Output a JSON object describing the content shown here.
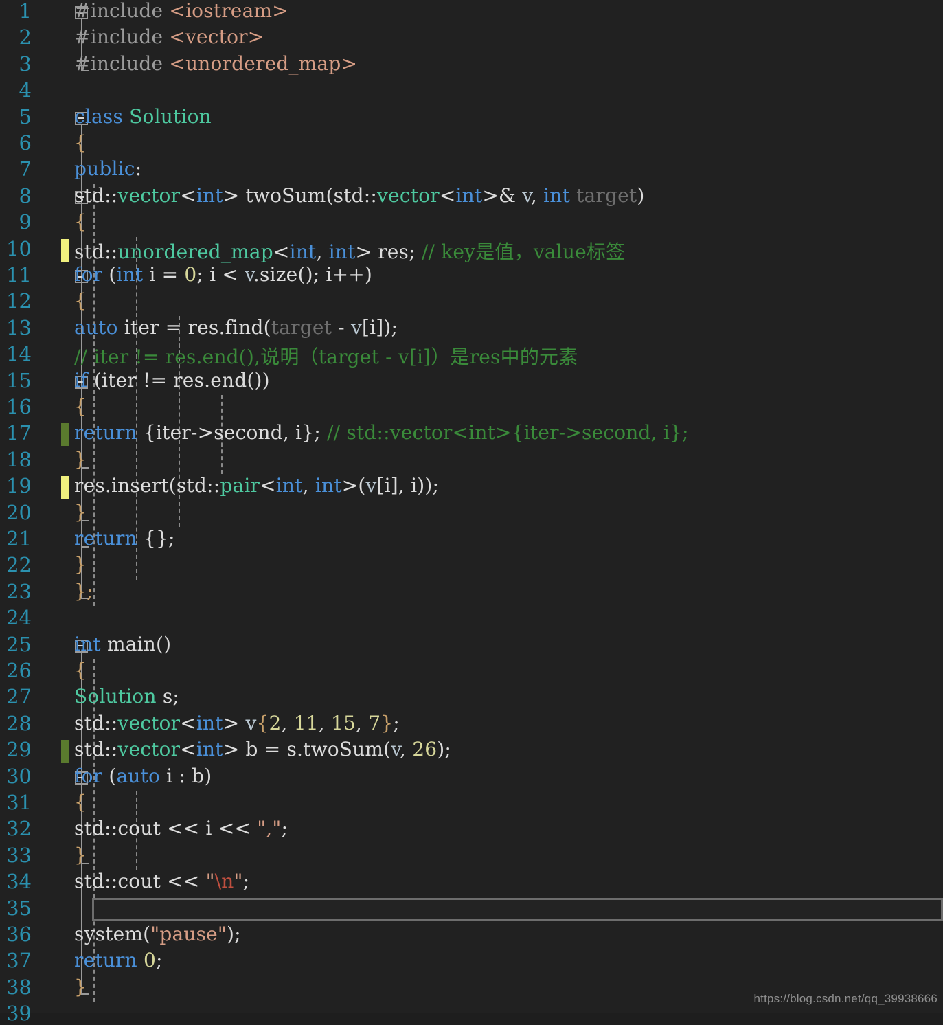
{
  "editor": {
    "theme_name": "dark",
    "background": "#212121",
    "line_number_color": "#2b91af",
    "font_size_px": 28,
    "line_height_px": 38.4,
    "current_line": 35,
    "total_visible_lines": 39,
    "change_markers": [
      {
        "line": 10,
        "color": "#f0f07e",
        "kind": "unsaved"
      },
      {
        "line": 17,
        "color": "#5a7a2e",
        "kind": "saved"
      },
      {
        "line": 19,
        "color": "#f0f07e",
        "kind": "unsaved"
      },
      {
        "line": 29,
        "color": "#5a7a2e",
        "kind": "saved"
      }
    ],
    "fold_markers": [
      1,
      5,
      8,
      11,
      15,
      25,
      30
    ],
    "watermark": "https://blog.csdn.net/qq_39938666",
    "line_numbers": [
      "1",
      "2",
      "3",
      "4",
      "5",
      "6",
      "7",
      "8",
      "9",
      "10",
      "11",
      "12",
      "13",
      "14",
      "15",
      "16",
      "17",
      "18",
      "19",
      "20",
      "21",
      "22",
      "23",
      "24",
      "25",
      "26",
      "27",
      "28",
      "29",
      "30",
      "31",
      "32",
      "33",
      "34",
      "35",
      "36",
      "37",
      "38",
      "39"
    ],
    "lines": [
      {
        "n": 1,
        "text": "#include <iostream>"
      },
      {
        "n": 2,
        "text": "#include <vector>"
      },
      {
        "n": 3,
        "text": "#include <unordered_map>"
      },
      {
        "n": 4,
        "text": ""
      },
      {
        "n": 5,
        "text": "class Solution"
      },
      {
        "n": 6,
        "text": "{"
      },
      {
        "n": 7,
        "text": "public:"
      },
      {
        "n": 8,
        "text": "    std::vector<int> twoSum(std::vector<int>& v, int target)"
      },
      {
        "n": 9,
        "text": "    {"
      },
      {
        "n": 10,
        "text": "        std::unordered_map<int, int> res; // key是值，value标签"
      },
      {
        "n": 11,
        "text": "        for (int i = 0; i < v.size(); i++)"
      },
      {
        "n": 12,
        "text": "        {"
      },
      {
        "n": 13,
        "text": "            auto iter = res.find(target - v[i]);"
      },
      {
        "n": 14,
        "text": "            // iter != res.end(),说明（target - v[i]）是res中的元素"
      },
      {
        "n": 15,
        "text": "            if (iter != res.end())"
      },
      {
        "n": 16,
        "text": "            {"
      },
      {
        "n": 17,
        "text": "                return {iter->second, i}; // std::vector<int>{iter->second, i};"
      },
      {
        "n": 18,
        "text": "            }"
      },
      {
        "n": 19,
        "text": "            res.insert(std::pair<int, int>(v[i], i));"
      },
      {
        "n": 20,
        "text": "        }"
      },
      {
        "n": 21,
        "text": "        return {};"
      },
      {
        "n": 22,
        "text": "    }"
      },
      {
        "n": 23,
        "text": "};"
      },
      {
        "n": 24,
        "text": ""
      },
      {
        "n": 25,
        "text": "int main()"
      },
      {
        "n": 26,
        "text": "{"
      },
      {
        "n": 27,
        "text": "    Solution s;"
      },
      {
        "n": 28,
        "text": "    std::vector<int> v{2, 11, 15, 7};"
      },
      {
        "n": 29,
        "text": "    std::vector<int> b = s.twoSum(v, 26);"
      },
      {
        "n": 30,
        "text": "    for (auto i : b)"
      },
      {
        "n": 31,
        "text": "    {"
      },
      {
        "n": 32,
        "text": "        std::cout << i << \",\";"
      },
      {
        "n": 33,
        "text": "    }"
      },
      {
        "n": 34,
        "text": "    std::cout << \"\\n\";"
      },
      {
        "n": 35,
        "text": ""
      },
      {
        "n": 36,
        "text": "    system(\"pause\");"
      },
      {
        "n": 37,
        "text": "    return 0;"
      },
      {
        "n": 38,
        "text": "}"
      },
      {
        "n": 39,
        "text": ""
      }
    ],
    "tokens": {
      "l1": [
        [
          "#include ",
          "pp"
        ],
        [
          "<iostream>",
          "ppstr"
        ]
      ],
      "l2": [
        [
          "#include ",
          "pp"
        ],
        [
          "<vector>",
          "ppstr"
        ]
      ],
      "l3": [
        [
          "#include ",
          "pp"
        ],
        [
          "<unordered_map>",
          "ppstr"
        ]
      ],
      "l5": [
        [
          "class ",
          "kw"
        ],
        [
          "Solution",
          "type"
        ]
      ],
      "l6": [
        [
          "{",
          "brace"
        ]
      ],
      "l7": [
        [
          "public",
          "kw"
        ],
        [
          ":",
          "plain"
        ]
      ],
      "l8": [
        [
          "    std::",
          "plain"
        ],
        [
          "vector",
          "type"
        ],
        [
          "<",
          "plain"
        ],
        [
          "int",
          "kw"
        ],
        [
          "> twoSum(std::",
          "plain"
        ],
        [
          "vector",
          "type"
        ],
        [
          "<",
          "plain"
        ],
        [
          "int",
          "kw"
        ],
        [
          ">& ",
          "plain"
        ],
        [
          "v",
          "var"
        ],
        [
          ", ",
          "plain"
        ],
        [
          "int",
          "kw"
        ],
        [
          " ",
          "plain"
        ],
        [
          "target",
          "dim"
        ],
        [
          ")",
          "plain"
        ]
      ],
      "l9": [
        [
          "    {",
          "brace"
        ]
      ],
      "l10": [
        [
          "        std::",
          "plain"
        ],
        [
          "unordered_map",
          "type"
        ],
        [
          "<",
          "plain"
        ],
        [
          "int",
          "kw"
        ],
        [
          ", ",
          "plain"
        ],
        [
          "int",
          "kw"
        ],
        [
          "> res; ",
          "plain"
        ],
        [
          "// key是值，value标签",
          "cmt"
        ]
      ],
      "l11": [
        [
          "        ",
          "plain"
        ],
        [
          "for",
          "kw"
        ],
        [
          " (",
          "plain"
        ],
        [
          "int",
          "kw"
        ],
        [
          " i = ",
          "plain"
        ],
        [
          "0",
          "num"
        ],
        [
          "; i < ",
          "plain"
        ],
        [
          "v",
          "var"
        ],
        [
          ".size(); i++)",
          "plain"
        ]
      ],
      "l12": [
        [
          "        {",
          "brace"
        ]
      ],
      "l13": [
        [
          "            ",
          "plain"
        ],
        [
          "auto",
          "kw"
        ],
        [
          " iter = res.find(",
          "plain"
        ],
        [
          "target",
          "dim"
        ],
        [
          " - ",
          "plain"
        ],
        [
          "v",
          "var"
        ],
        [
          "[i]);",
          "plain"
        ]
      ],
      "l14": [
        [
          "            // iter != res.end(),说明（target - v[i]）是res中的元素",
          "cmt"
        ]
      ],
      "l15": [
        [
          "            ",
          "plain"
        ],
        [
          "if",
          "kw"
        ],
        [
          " (iter != res.end())",
          "plain"
        ]
      ],
      "l16": [
        [
          "            {",
          "brace"
        ]
      ],
      "l17": [
        [
          "                ",
          "plain"
        ],
        [
          "return",
          "kw"
        ],
        [
          " {iter->second, i}; ",
          "plain"
        ],
        [
          "// std::vector<int>{iter->second, i};",
          "cmt"
        ]
      ],
      "l18": [
        [
          "            }",
          "brace"
        ]
      ],
      "l19": [
        [
          "            res.insert(std::",
          "plain"
        ],
        [
          "pair",
          "type"
        ],
        [
          "<",
          "plain"
        ],
        [
          "int",
          "kw"
        ],
        [
          ", ",
          "plain"
        ],
        [
          "int",
          "kw"
        ],
        [
          ">(",
          "plain"
        ],
        [
          "v",
          "var"
        ],
        [
          "[i], i));",
          "plain"
        ]
      ],
      "l20": [
        [
          "        }",
          "brace"
        ]
      ],
      "l21": [
        [
          "        ",
          "plain"
        ],
        [
          "return",
          "kw"
        ],
        [
          " {};",
          "plain"
        ]
      ],
      "l22": [
        [
          "    }",
          "brace"
        ]
      ],
      "l23": [
        [
          "};",
          "brace"
        ]
      ],
      "l25": [
        [
          "int",
          "kw"
        ],
        [
          " main()",
          "plain"
        ]
      ],
      "l26": [
        [
          "{",
          "brace"
        ]
      ],
      "l27": [
        [
          "    ",
          "plain"
        ],
        [
          "Solution",
          "type"
        ],
        [
          " s;",
          "plain"
        ]
      ],
      "l28": [
        [
          "    std::",
          "plain"
        ],
        [
          "vector",
          "type"
        ],
        [
          "<",
          "plain"
        ],
        [
          "int",
          "kw"
        ],
        [
          "> ",
          "plain"
        ],
        [
          "v",
          "var"
        ],
        [
          "{",
          "brace"
        ],
        [
          "2",
          "num"
        ],
        [
          ", ",
          "plain"
        ],
        [
          "11",
          "num"
        ],
        [
          ", ",
          "plain"
        ],
        [
          "15",
          "num"
        ],
        [
          ", ",
          "plain"
        ],
        [
          "7",
          "num"
        ],
        [
          "}",
          "brace"
        ],
        [
          ";",
          "plain"
        ]
      ],
      "l29": [
        [
          "    std::",
          "plain"
        ],
        [
          "vector",
          "type"
        ],
        [
          "<",
          "plain"
        ],
        [
          "int",
          "kw"
        ],
        [
          "> b = s.twoSum(",
          "plain"
        ],
        [
          "v",
          "var"
        ],
        [
          ", ",
          "plain"
        ],
        [
          "26",
          "num"
        ],
        [
          ");",
          "plain"
        ]
      ],
      "l30": [
        [
          "    ",
          "plain"
        ],
        [
          "for",
          "kw"
        ],
        [
          " (",
          "plain"
        ],
        [
          "auto",
          "kw"
        ],
        [
          " i : b)",
          "plain"
        ]
      ],
      "l31": [
        [
          "    {",
          "brace"
        ]
      ],
      "l32": [
        [
          "        std::cout << i << ",
          "plain"
        ],
        [
          "\",\"",
          "str"
        ],
        [
          ";",
          "plain"
        ]
      ],
      "l33": [
        [
          "    }",
          "brace"
        ]
      ],
      "l34": [
        [
          "    std::cout << ",
          "plain"
        ],
        [
          "\"",
          "str"
        ],
        [
          "\\n",
          "esc"
        ],
        [
          "\"",
          "str"
        ],
        [
          ";",
          "plain"
        ]
      ],
      "l36": [
        [
          "    system(",
          "plain"
        ],
        [
          "\"pause\"",
          "str"
        ],
        [
          ");",
          "plain"
        ]
      ],
      "l37": [
        [
          "    ",
          "plain"
        ],
        [
          "return",
          "kw"
        ],
        [
          " ",
          "plain"
        ],
        [
          "0",
          "num"
        ],
        [
          ";",
          "plain"
        ]
      ],
      "l38": [
        [
          "}",
          "brace"
        ]
      ]
    }
  }
}
